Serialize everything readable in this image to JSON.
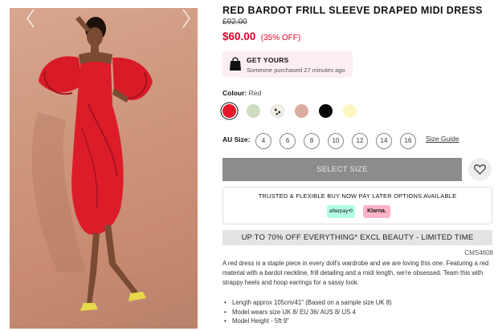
{
  "product": {
    "title": "RED BARDOT FRILL SLEEVE DRAPED MIDI DRESS",
    "old_price": "£92.00",
    "new_price": "$60.00",
    "discount": "(35% OFF)",
    "image_icon": "model-in-red-dress-photo"
  },
  "get_yours": {
    "icon": "shopping-bag-icon",
    "title": "GET YOURS",
    "subtitle": "Someone purchased 27 minutes ago"
  },
  "colour": {
    "label": "Colour:",
    "selected": "Red",
    "swatches": [
      {
        "name": "red",
        "color": "#e8142b"
      },
      {
        "name": "sage",
        "color": "#cfdcc0"
      },
      {
        "name": "polka-dot",
        "color": "#f2efe6"
      },
      {
        "name": "blush",
        "color": "#d9ad9f"
      },
      {
        "name": "black",
        "color": "#050505"
      },
      {
        "name": "pale-yellow",
        "color": "#fdf6c0"
      }
    ]
  },
  "sizes": {
    "label": "AU Size:",
    "options": [
      "4",
      "6",
      "8",
      "10",
      "12",
      "14",
      "16"
    ],
    "guide": "Size Guide"
  },
  "cta": {
    "select_size": "SELECT SIZE",
    "wishlist_icon": "heart-icon"
  },
  "bnpl": {
    "title": "TRUSTED & FLEXIBLE BUY NOW PAY LATER OPTIONS AVAILABLE",
    "afterpay": "afterpay⟲",
    "klarna": "Klarna."
  },
  "promo": "UP TO 70% OFF EVERYTHING* EXCL BEAUTY - LIMITED TIME",
  "code": "CMS4608",
  "description": "A red dress is a staple piece in every doll's wardrobe and we are loving this one. Featuring a red material with a bardot neckline, frill detailing and a midi length, we're obsessed. Team this with strappy heels and hoop earrings for a sassy look.",
  "bullets": [
    "Length approx 105cm/41\" (Based on a sample size UK 8)",
    "Model wears size UK 8/ EU 36/ AUS 8/ US 4",
    "Model Height - 5ft 9\""
  ],
  "colors": {
    "accent_red": "#e4002b",
    "button_grey": "#8c8c8c",
    "promo_bg": "#e4e4e4"
  }
}
